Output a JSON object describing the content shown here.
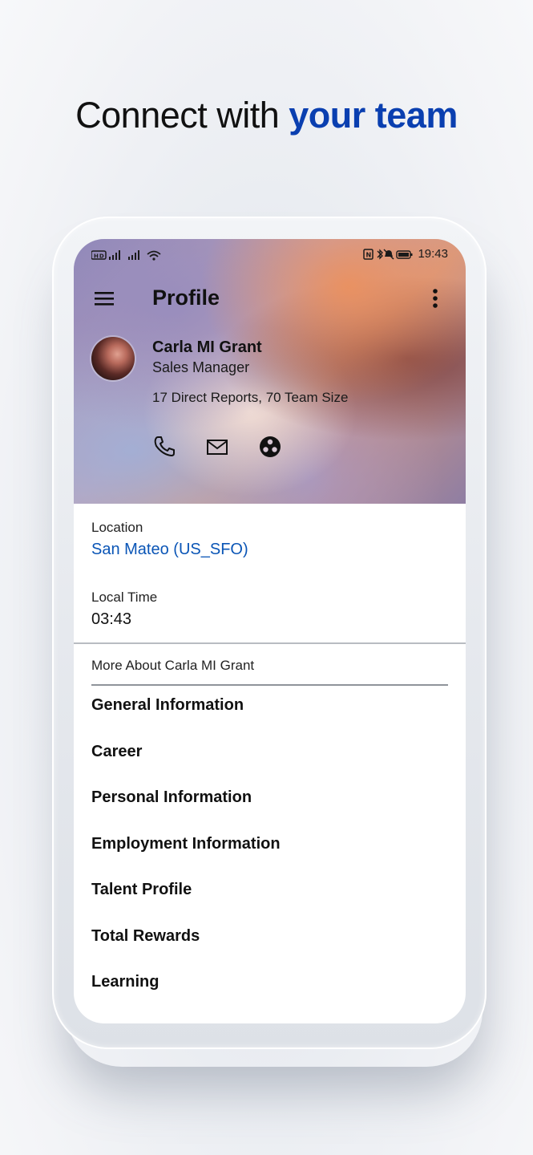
{
  "headline": {
    "part1": "Connect with ",
    "part2": "your team",
    "accent_color": "#0a3fb0"
  },
  "status_bar": {
    "left_indicators": "HD ⁴ᴳ.ıll ⁴ᴳ.ıll",
    "time": "19:43",
    "battery": "100"
  },
  "app_bar": {
    "title": "Profile",
    "menu_icon": "hamburger-menu-icon",
    "overflow_icon": "more-vertical-icon"
  },
  "profile": {
    "name": "Carla MI Grant",
    "job_title": "Sales Manager",
    "team_info": "17 Direct Reports, 70 Team Size",
    "actions": [
      "phone-icon",
      "email-icon",
      "org-chart-icon"
    ]
  },
  "location": {
    "label": "Location",
    "value": "San Mateo (US_SFO)",
    "link_color": "#0a55b6"
  },
  "local_time": {
    "label": "Local Time",
    "value": "03:43"
  },
  "more_about": {
    "label": "More About Carla MI Grant"
  },
  "sections": [
    "General Information",
    "Career",
    "Personal Information",
    "Employment Information",
    "Talent Profile",
    "Total Rewards",
    "Learning"
  ]
}
